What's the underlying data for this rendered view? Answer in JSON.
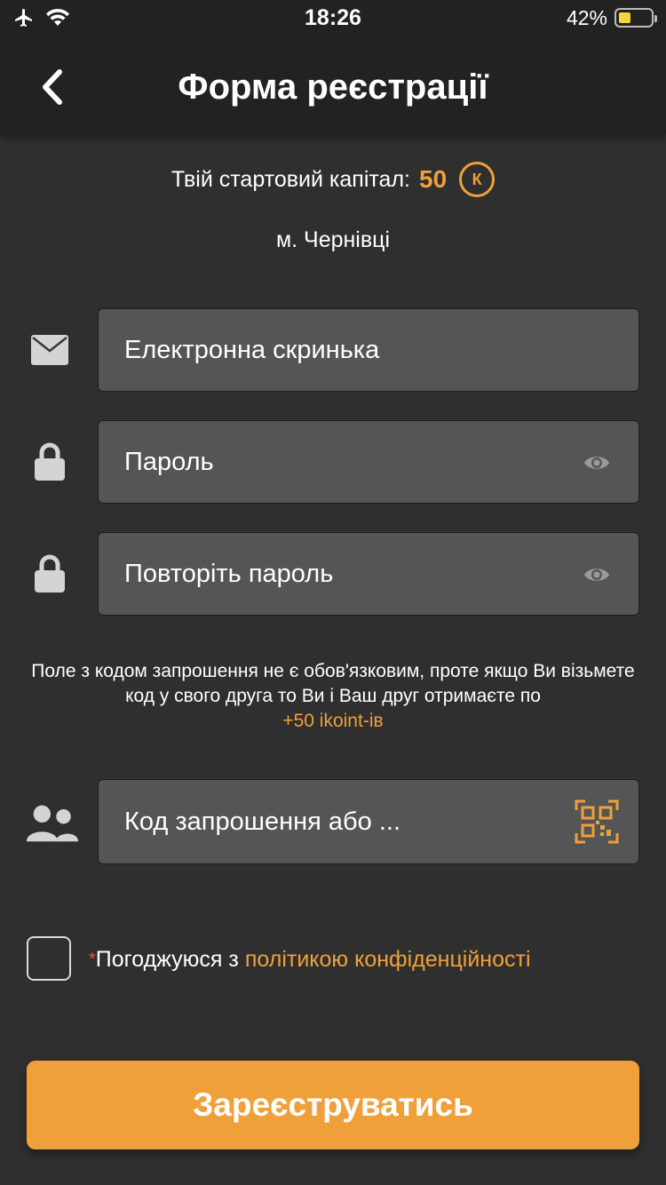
{
  "status_bar": {
    "time": "18:26",
    "battery_percent_label": "42%",
    "battery_level": 0.42,
    "icons": [
      "airplane-icon",
      "wifi-icon",
      "battery-icon"
    ]
  },
  "header": {
    "title": "Форма реєстрації",
    "back_icon": "chevron-left-icon"
  },
  "capital": {
    "label": "Твій стартовий капітал:",
    "amount": "50",
    "coin_symbol": "К"
  },
  "city": "м. Чернівці",
  "form": {
    "email_placeholder": "Електронна скринька",
    "password_placeholder": "Пароль",
    "repeat_password_placeholder": "Повторіть пароль",
    "invite_placeholder": "Код запрошення або ..."
  },
  "invite_info": {
    "text": "Поле з кодом запрошення не є обов'язковим, проте якщо Ви візьмете код у свого друга то Ви і Ваш друг отримаєте по",
    "bonus": "+50 ikoint-ів"
  },
  "agreement": {
    "required_mark": "*",
    "text": "Погоджуюся з",
    "policy_link": "політикою конфіденційності",
    "checked": false
  },
  "register_button": "Зареєструватись",
  "colors": {
    "accent": "#f0a03a",
    "background": "#2f2f2f",
    "header": "#222222",
    "field": "#555555",
    "required": "#e05a3a"
  }
}
